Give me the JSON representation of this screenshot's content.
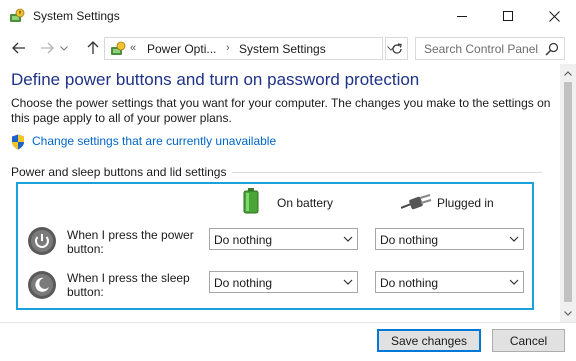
{
  "window": {
    "title": "System Settings",
    "icon": "power-options-icon"
  },
  "navigation": {
    "back_icon": "arrow-left-icon",
    "forward_icon": "arrow-right-icon",
    "up_icon": "arrow-up-icon",
    "breadcrumb_separator_first": "«",
    "breadcrumb": [
      "Power Opti...",
      "System Settings"
    ],
    "breadcrumb_separator": "›",
    "refresh_icon": "refresh-icon",
    "search_placeholder": "Search Control Panel"
  },
  "page": {
    "heading": "Define power buttons and turn on password protection",
    "description": "Choose the power settings that you want for your computer. The changes you make to the settings on this page apply to all of your power plans.",
    "change_link": "Change settings that are currently unavailable",
    "group_title": "Power and sleep buttons and lid settings",
    "columns": [
      {
        "label": "On battery",
        "icon": "battery-icon"
      },
      {
        "label": "Plugged in",
        "icon": "power-plug-icon"
      }
    ],
    "rows": [
      {
        "label": "When I press the power button:",
        "icon": "power-button-icon",
        "on_battery": "Do nothing",
        "plugged_in": "Do nothing"
      },
      {
        "label": "When I press the sleep button:",
        "icon": "sleep-button-icon",
        "on_battery": "Do nothing",
        "plugged_in": "Do nothing"
      }
    ]
  },
  "footer": {
    "save_label": "Save changes",
    "cancel_label": "Cancel"
  },
  "colors": {
    "heading": "#1e3287",
    "link": "#0066cc",
    "highlight_border": "#1aa0db",
    "primary_button_border": "#0078d7"
  }
}
